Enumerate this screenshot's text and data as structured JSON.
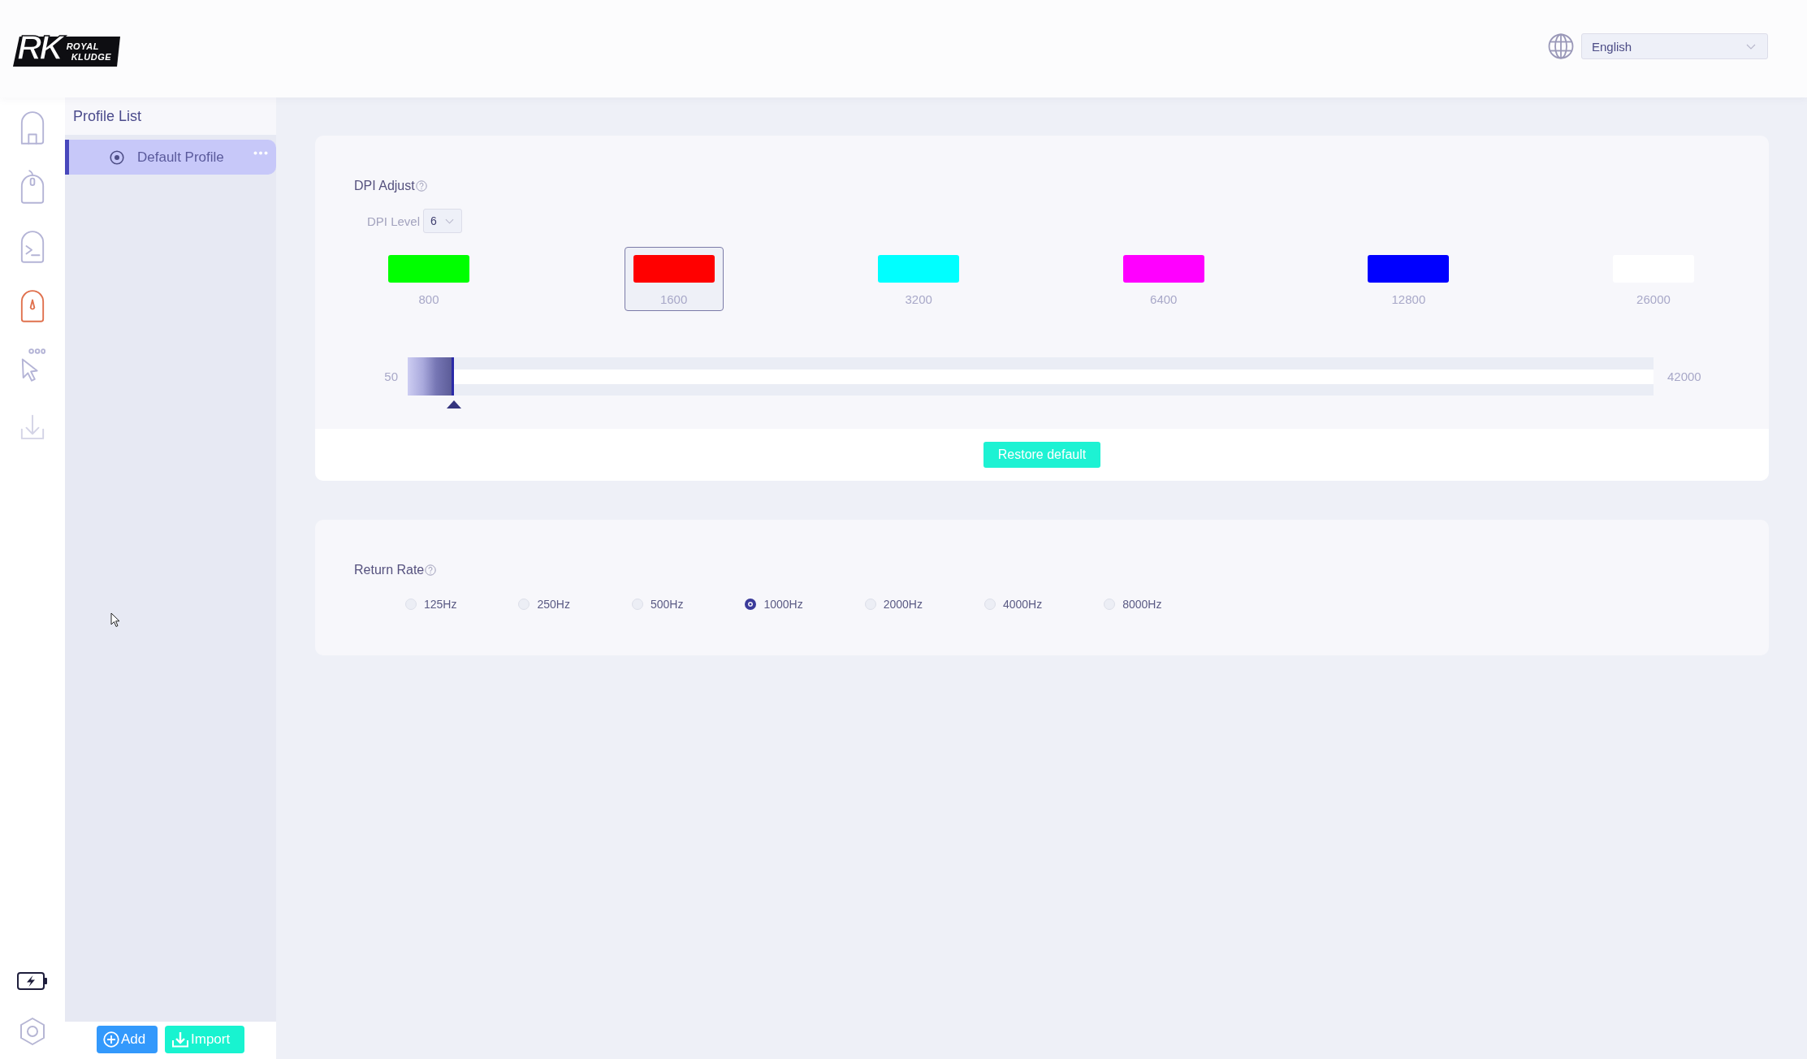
{
  "header": {
    "logo": {
      "monogram": "RK",
      "line_1": "ROYAL",
      "line_2": "KLUDGE"
    },
    "language_select": {
      "value": "English"
    }
  },
  "nav_rail": {
    "items": [
      {
        "selected": false,
        "disabled": false
      },
      {
        "selected": false,
        "disabled": false
      },
      {
        "selected": false,
        "disabled": false
      },
      {
        "selected": true,
        "disabled": false
      },
      {
        "selected": false,
        "disabled": false
      },
      {
        "selected": false,
        "disabled": true
      }
    ]
  },
  "profile_list": {
    "title": "Profile List",
    "items": [
      {
        "name": "Default Profile",
        "selected": true
      }
    ],
    "buttons": [
      {
        "kind": "add",
        "label": "Add"
      },
      {
        "kind": "import",
        "label": "Import"
      }
    ]
  },
  "dpi_adjust": {
    "title": "DPI Adjust",
    "level_label": "DPI Level",
    "level_value": "6",
    "stages": [
      {
        "value": "800",
        "color": "#00ff00",
        "selected": false
      },
      {
        "value": "1600",
        "color": "#ff0000",
        "selected": true
      },
      {
        "value": "3200",
        "color": "#00ffff",
        "selected": false
      },
      {
        "value": "6400",
        "color": "#ff00ff",
        "selected": false
      },
      {
        "value": "12800",
        "color": "#0000ff",
        "selected": false
      },
      {
        "value": "26000",
        "color": "#ffffff",
        "selected": false
      }
    ],
    "slider": {
      "min_label": "50",
      "max_label": "42000",
      "level": 0.037
    },
    "restore_button": "Restore default"
  },
  "return_rate": {
    "title": "Return Rate",
    "options": [
      {
        "label": "125Hz",
        "selected": false
      },
      {
        "label": "250Hz",
        "selected": false
      },
      {
        "label": "500Hz",
        "selected": false
      },
      {
        "label": "1000Hz",
        "selected": true
      },
      {
        "label": "2000Hz",
        "selected": false
      },
      {
        "label": "4000Hz",
        "selected": false
      },
      {
        "label": "8000Hz",
        "selected": false
      }
    ]
  }
}
